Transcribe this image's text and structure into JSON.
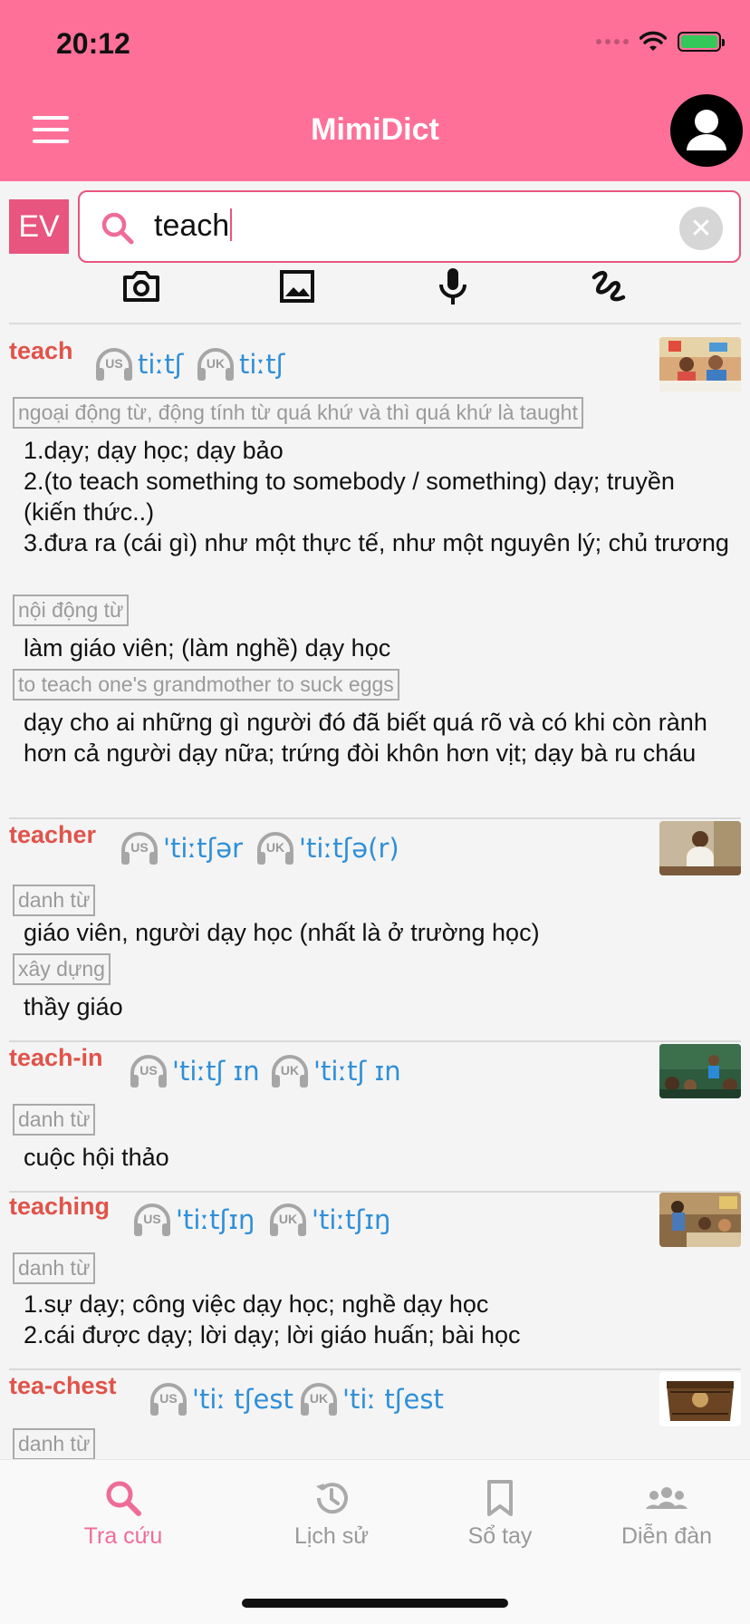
{
  "status_bar": {
    "time": "20:12"
  },
  "header": {
    "title": "MimiDict"
  },
  "search": {
    "lang": "EV",
    "query": "teach"
  },
  "tools": [
    "camera-icon",
    "image-icon",
    "microphone-icon",
    "handwriting-icon"
  ],
  "entries": [
    {
      "word": "teach",
      "us_ipa": "tiːtʃ",
      "uk_ipa": "tiːtʃ",
      "blocks": [
        {
          "tag": "ngoại động từ, động tính từ quá khứ và thì quá khứ là taught",
          "defs": [
            "1.dạy; dạy học; dạy bảo",
            "2.(to teach something to somebody / something) dạy; truyền (kiến thức..)",
            "3.đưa ra (cái gì) như một thực tế, như một nguyên lý; chủ trương"
          ]
        },
        {
          "tag": "nội động từ",
          "defs": [
            "làm giáo viên; (làm nghề) dạy học"
          ]
        },
        {
          "tag": "to teach one's grandmother to suck eggs",
          "defs": [
            "dạy cho ai những gì người đó đã biết quá rõ và có khi còn rành hơn cả người dạy nữa; trứng đòi khôn hơn vịt; dạy bà ru cháu"
          ]
        }
      ]
    },
    {
      "word": "teacher",
      "us_ipa": "'tiːtʃər",
      "uk_ipa": "'tiːtʃə(r)",
      "blocks": [
        {
          "tag": "danh từ",
          "defs": [
            "giáo viên, người dạy học (nhất là ở trường học)"
          ]
        },
        {
          "tag": "xây dựng",
          "defs": [
            "thầy giáo"
          ]
        }
      ]
    },
    {
      "word": "teach-in",
      "us_ipa": "'tiːtʃ ɪn",
      "uk_ipa": "'tiːtʃ ɪn",
      "blocks": [
        {
          "tag": "danh từ",
          "defs": [
            "cuộc hội thảo"
          ]
        }
      ]
    },
    {
      "word": "teaching",
      "us_ipa": "'tiːtʃɪŋ",
      "uk_ipa": "'tiːtʃɪŋ",
      "blocks": [
        {
          "tag": "danh từ",
          "defs": [
            "1.sự dạy; công việc dạy học; nghề dạy học",
            "2.cái được dạy; lời dạy; lời giáo huấn; bài học"
          ]
        }
      ]
    },
    {
      "word": "tea-chest",
      "us_ipa": "'tiː tʃest",
      "uk_ipa": "'tiː tʃest",
      "blocks": [
        {
          "tag": "danh từ",
          "defs": []
        }
      ]
    }
  ],
  "labels": {
    "us": "US",
    "uk": "UK"
  },
  "tabs": [
    {
      "label": "Tra cứu",
      "icon": "search-icon",
      "active": true
    },
    {
      "label": "Lịch sử",
      "icon": "history-icon",
      "active": false
    },
    {
      "label": "Sổ tay",
      "icon": "bookmark-icon",
      "active": false
    },
    {
      "label": "Diễn đàn",
      "icon": "people-icon",
      "active": false
    }
  ],
  "colors": {
    "header": "#ff7099",
    "accent": "#e8557e",
    "word": "#e0534a",
    "ipa": "#2f8fd8"
  }
}
